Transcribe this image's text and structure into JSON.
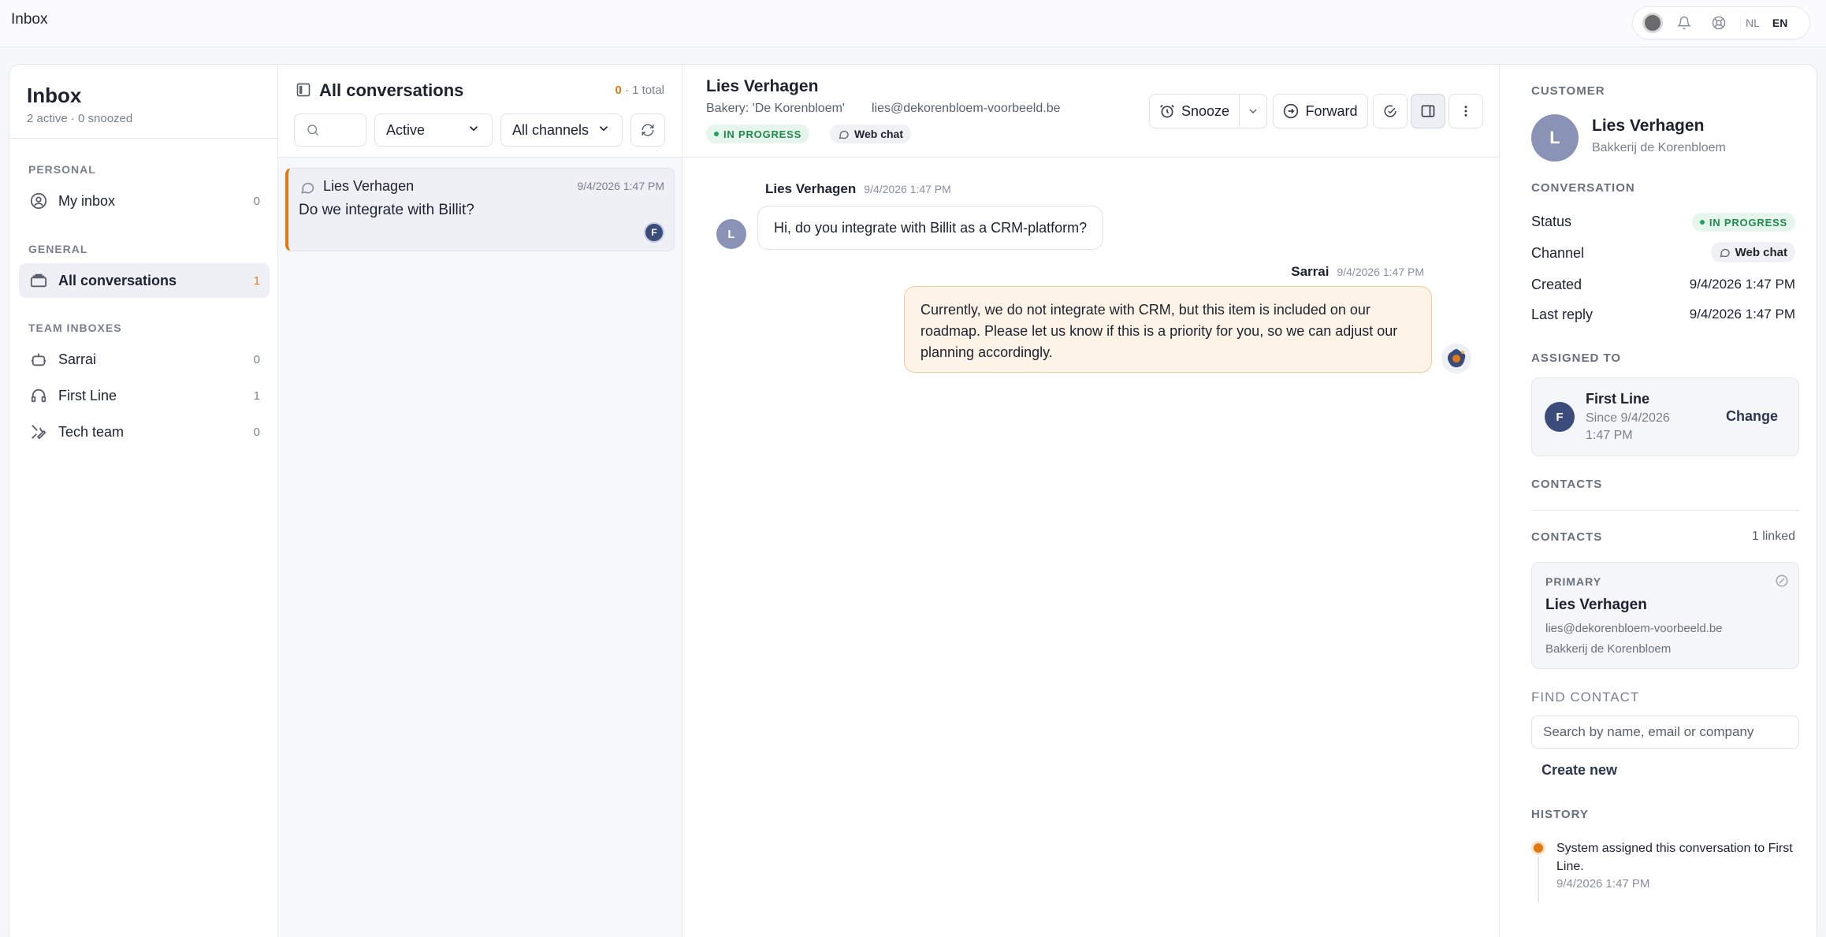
{
  "app": {
    "title": "Inbox"
  },
  "topbar": {
    "lang_nl": "NL",
    "lang_en": "EN",
    "icons": [
      "status-dot",
      "bell-icon",
      "lifebuoy-icon"
    ]
  },
  "sidebar": {
    "title": "Inbox",
    "subtitle": "2 active · 0 snoozed",
    "sections": {
      "personal": "PERSONAL",
      "general": "GENERAL",
      "team": "TEAM INBOXES"
    },
    "items": [
      {
        "label": "My inbox",
        "count": "0",
        "icon": "user-circle-icon"
      },
      {
        "label": "All conversations",
        "count": "1",
        "icon": "inbox-tray-icon"
      },
      {
        "label": "Sarrai",
        "count": "0",
        "icon": "robot-icon"
      },
      {
        "label": "First Line",
        "count": "1",
        "icon": "headset-icon"
      },
      {
        "label": "Tech team",
        "count": "0",
        "icon": "tools-icon"
      }
    ]
  },
  "list": {
    "title": "All conversations",
    "total_count": "0",
    "total_suffix": " · 1 total",
    "search_placeholder": "",
    "status_filter": "Active",
    "channel_filter": "All channels",
    "conversations": [
      {
        "name": "Lies Verhagen",
        "time": "9/4/2026 1:47 PM",
        "preview": "Do we integrate with Billit?",
        "assignee_initial": "F"
      }
    ]
  },
  "chat": {
    "contact_name": "Lies Verhagen",
    "company": "Bakery: 'De Korenbloem'",
    "email": "lies@dekorenbloem-voorbeeld.be",
    "status": "IN PROGRESS",
    "channel": "Web chat",
    "buttons": {
      "snooze": "Snooze",
      "forward": "Forward"
    },
    "messages": [
      {
        "sender": "Lies Verhagen",
        "time": "9/4/2026 1:47 PM",
        "text": "Hi, do you integrate with Billit as a CRM-platform?",
        "initial": "L"
      },
      {
        "sender": "Sarrai",
        "time": "9/4/2026 1:47 PM",
        "text": "Currently, we do not integrate with CRM, but this item is included on our roadmap. Please let us know if this is a priority for you, so we can adjust our planning accordingly."
      }
    ]
  },
  "panel": {
    "customer_label": "CUSTOMER",
    "customer_initial": "L",
    "customer_name": "Lies Verhagen",
    "customer_company": "Bakkerij de Korenbloem",
    "conversation_label": "CONVERSATION",
    "status_key": "Status",
    "status_value": "IN PROGRESS",
    "channel_key": "Channel",
    "channel_value": "Web chat",
    "created_key": "Created",
    "created_value": "9/4/2026 1:47 PM",
    "last_reply_key": "Last reply",
    "last_reply_value": "9/4/2026 1:47 PM",
    "assigned_label": "ASSIGNED TO",
    "assignee_initial": "F",
    "assignee_name": "First Line",
    "assignee_since": "Since 9/4/2026 1:47 PM",
    "change_label": "Change",
    "contacts_label_1": "CONTACTS",
    "contacts_label_2": "CONTACTS",
    "contacts_linked": "1 linked",
    "primary_tag": "PRIMARY",
    "contact_name": "Lies Verhagen",
    "contact_email": "lies@dekorenbloem-voorbeeld.be",
    "contact_company": "Bakkerij de Korenbloem",
    "find_contact_label": "FIND CONTACT",
    "find_placeholder": "Search by name, email or company",
    "create_new": "Create new",
    "history_label": "HISTORY",
    "history_text": "System assigned this conversation to First Line.",
    "history_time": "9/4/2026 1:47 PM"
  },
  "colors": {
    "accent": "#e07a14",
    "status_green": "#1f8a4c",
    "assignee_blue": "#3b4b7a"
  }
}
